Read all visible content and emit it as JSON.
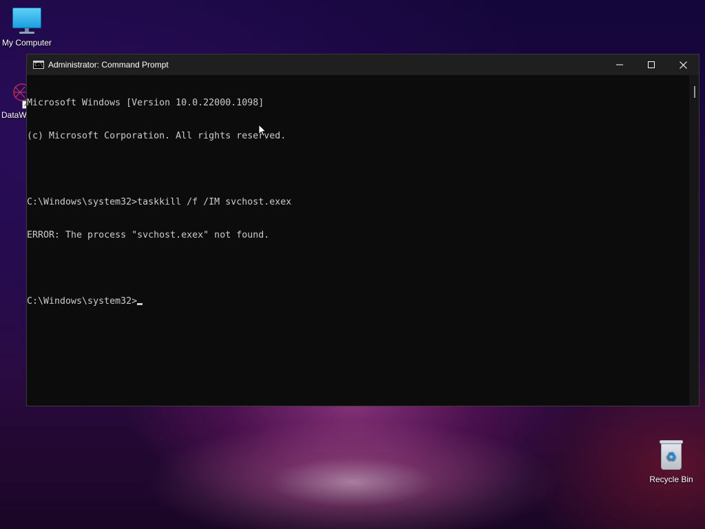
{
  "desktop": {
    "icons": {
      "my_computer": "My Computer",
      "dataw": "DataW",
      "recycle_bin": "Recycle Bin"
    }
  },
  "window": {
    "title": "Administrator: Command Prompt",
    "app_icon": "cmd-icon",
    "app_icon_text": "C:\\",
    "buttons": {
      "minimize": "minimize-icon",
      "maximize": "maximize-icon",
      "close": "close-icon"
    }
  },
  "console": {
    "lines": [
      "Microsoft Windows [Version 10.0.22000.1098]",
      "(c) Microsoft Corporation. All rights reserved.",
      "",
      "C:\\Windows\\system32>taskkill /f /IM svchost.exex",
      "ERROR: The process \"svchost.exex\" not found.",
      "",
      "C:\\Windows\\system32>"
    ]
  },
  "colors": {
    "console_bg": "#0c0c0c",
    "console_text": "#cccccc",
    "titlebar_bg": "#1f1f1f"
  }
}
